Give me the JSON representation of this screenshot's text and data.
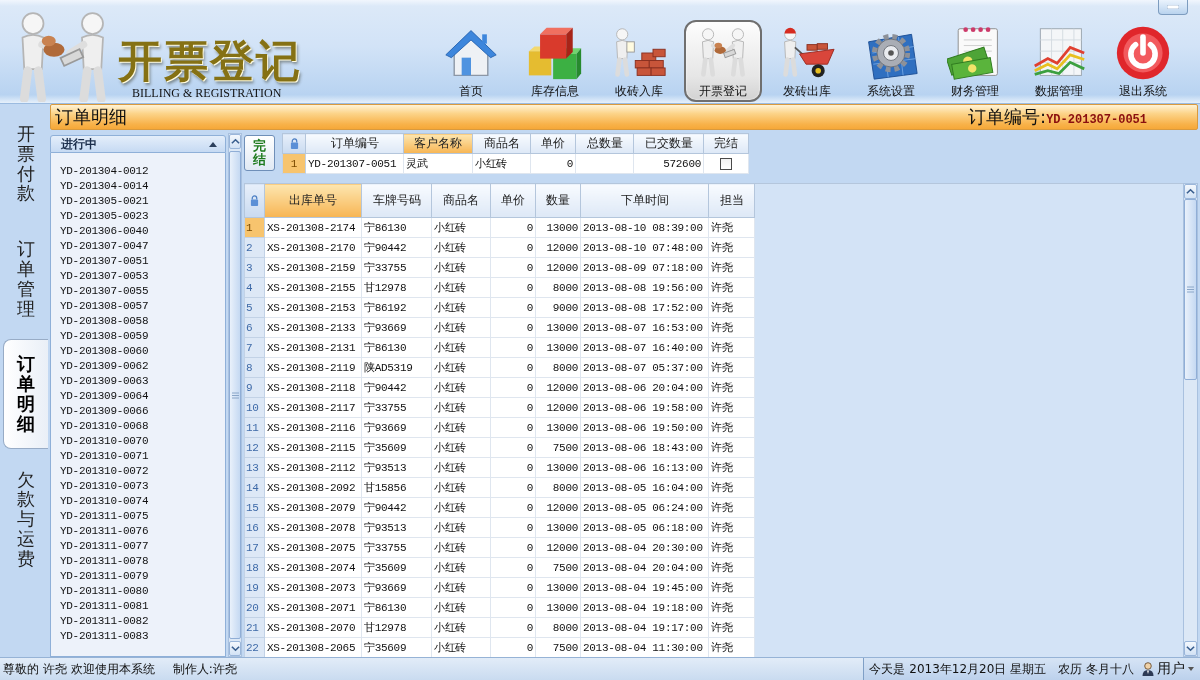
{
  "header": {
    "title": "开票登记",
    "subtitle": "BILLING & REGISTRATION",
    "nav": [
      {
        "label": "首页",
        "kind": "home",
        "selected": false
      },
      {
        "label": "库存信息",
        "kind": "boxes",
        "selected": false
      },
      {
        "label": "收砖入库",
        "kind": "bricks",
        "selected": false
      },
      {
        "label": "开票登记",
        "kind": "handover",
        "selected": true
      },
      {
        "label": "发砖出库",
        "kind": "wheelbarrow",
        "selected": false
      },
      {
        "label": "系统设置",
        "kind": "gear",
        "selected": false
      },
      {
        "label": "财务管理",
        "kind": "money",
        "selected": false
      },
      {
        "label": "数据管理",
        "kind": "chart",
        "selected": false
      },
      {
        "label": "退出系统",
        "kind": "power",
        "selected": false
      }
    ]
  },
  "side_tabs": [
    {
      "label": "开票付款",
      "selected": false
    },
    {
      "label": "订单管理",
      "selected": false
    },
    {
      "label": "订单明细",
      "selected": true
    },
    {
      "label": "欠款与运费",
      "selected": false
    }
  ],
  "page_bar": {
    "title": "订单明细",
    "order_label": "订单编号:",
    "order_number": "YD-201307-0051"
  },
  "order_list": {
    "title": "进行中",
    "items": [
      "YD-201304-0012",
      "YD-201304-0014",
      "YD-201305-0021",
      "YD-201305-0023",
      "YD-201306-0040",
      "YD-201307-0047",
      "YD-201307-0051",
      "YD-201307-0053",
      "YD-201307-0055",
      "YD-201308-0057",
      "YD-201308-0058",
      "YD-201308-0059",
      "YD-201308-0060",
      "YD-201309-0062",
      "YD-201309-0063",
      "YD-201309-0064",
      "YD-201309-0066",
      "YD-201310-0068",
      "YD-201310-0070",
      "YD-201310-0071",
      "YD-201310-0072",
      "YD-201310-0073",
      "YD-201310-0074",
      "YD-201311-0075",
      "YD-201311-0076",
      "YD-201311-0077",
      "YD-201311-0078",
      "YD-201311-0079",
      "YD-201311-0080",
      "YD-201311-0081",
      "YD-201311-0082",
      "YD-201311-0083"
    ]
  },
  "order_summary": {
    "button": "完结",
    "columns": [
      {
        "label": "订单编号",
        "selected": false
      },
      {
        "label": "客户名称",
        "selected": true
      },
      {
        "label": "商品名",
        "selected": false
      },
      {
        "label": "单价",
        "selected": false
      },
      {
        "label": "总数量",
        "selected": false
      },
      {
        "label": "已交数量",
        "selected": false
      },
      {
        "label": "完结",
        "selected": false
      }
    ],
    "rows": [
      {
        "index": "1",
        "selected": true,
        "order_no": "YD-201307-0051",
        "customer": "灵武",
        "product": "小红砖",
        "unit_price": "0",
        "delivered": "572600",
        "checked": false
      }
    ]
  },
  "shipments": {
    "columns": [
      {
        "label": "出库单号",
        "selected": true
      },
      {
        "label": "车牌号码",
        "selected": false
      },
      {
        "label": "商品名",
        "selected": false
      },
      {
        "label": "单价",
        "selected": false
      },
      {
        "label": "数量",
        "selected": false
      },
      {
        "label": "下单时间",
        "selected": false
      },
      {
        "label": "担当",
        "selected": false
      }
    ],
    "rows": [
      {
        "index": "1",
        "selected": true,
        "cells": [
          "XS-201308-2174",
          "宁86130",
          "小红砖",
          "0",
          "13000",
          "2013-08-10 08:39:00",
          "许尧"
        ]
      },
      {
        "index": "2",
        "selected": false,
        "cells": [
          "XS-201308-2170",
          "宁90442",
          "小红砖",
          "0",
          "12000",
          "2013-08-10 07:48:00",
          "许尧"
        ]
      },
      {
        "index": "3",
        "selected": false,
        "cells": [
          "XS-201308-2159",
          "宁33755",
          "小红砖",
          "0",
          "12000",
          "2013-08-09 07:18:00",
          "许尧"
        ]
      },
      {
        "index": "4",
        "selected": false,
        "cells": [
          "XS-201308-2155",
          "甘12978",
          "小红砖",
          "0",
          "8000",
          "2013-08-08 19:56:00",
          "许尧"
        ]
      },
      {
        "index": "5",
        "selected": false,
        "cells": [
          "XS-201308-2153",
          "宁86192",
          "小红砖",
          "0",
          "9000",
          "2013-08-08 17:52:00",
          "许尧"
        ]
      },
      {
        "index": "6",
        "selected": false,
        "cells": [
          "XS-201308-2133",
          "宁93669",
          "小红砖",
          "0",
          "13000",
          "2013-08-07 16:53:00",
          "许尧"
        ]
      },
      {
        "index": "7",
        "selected": false,
        "cells": [
          "XS-201308-2131",
          "宁86130",
          "小红砖",
          "0",
          "13000",
          "2013-08-07 16:40:00",
          "许尧"
        ]
      },
      {
        "index": "8",
        "selected": false,
        "cells": [
          "XS-201308-2119",
          "陕AD5319",
          "小红砖",
          "0",
          "8000",
          "2013-08-07 05:37:00",
          "许尧"
        ]
      },
      {
        "index": "9",
        "selected": false,
        "cells": [
          "XS-201308-2118",
          "宁90442",
          "小红砖",
          "0",
          "12000",
          "2013-08-06 20:04:00",
          "许尧"
        ]
      },
      {
        "index": "10",
        "selected": false,
        "cells": [
          "XS-201308-2117",
          "宁33755",
          "小红砖",
          "0",
          "12000",
          "2013-08-06 19:58:00",
          "许尧"
        ]
      },
      {
        "index": "11",
        "selected": false,
        "cells": [
          "XS-201308-2116",
          "宁93669",
          "小红砖",
          "0",
          "13000",
          "2013-08-06 19:50:00",
          "许尧"
        ]
      },
      {
        "index": "12",
        "selected": false,
        "cells": [
          "XS-201308-2115",
          "宁35609",
          "小红砖",
          "0",
          "7500",
          "2013-08-06 18:43:00",
          "许尧"
        ]
      },
      {
        "index": "13",
        "selected": false,
        "cells": [
          "XS-201308-2112",
          "宁93513",
          "小红砖",
          "0",
          "13000",
          "2013-08-06 16:13:00",
          "许尧"
        ]
      },
      {
        "index": "14",
        "selected": false,
        "cells": [
          "XS-201308-2092",
          "甘15856",
          "小红砖",
          "0",
          "8000",
          "2013-08-05 16:04:00",
          "许尧"
        ]
      },
      {
        "index": "15",
        "selected": false,
        "cells": [
          "XS-201308-2079",
          "宁90442",
          "小红砖",
          "0",
          "12000",
          "2013-08-05 06:24:00",
          "许尧"
        ]
      },
      {
        "index": "16",
        "selected": false,
        "cells": [
          "XS-201308-2078",
          "宁93513",
          "小红砖",
          "0",
          "13000",
          "2013-08-05 06:18:00",
          "许尧"
        ]
      },
      {
        "index": "17",
        "selected": false,
        "cells": [
          "XS-201308-2075",
          "宁33755",
          "小红砖",
          "0",
          "12000",
          "2013-08-04 20:30:00",
          "许尧"
        ]
      },
      {
        "index": "18",
        "selected": false,
        "cells": [
          "XS-201308-2074",
          "宁35609",
          "小红砖",
          "0",
          "7500",
          "2013-08-04 20:04:00",
          "许尧"
        ]
      },
      {
        "index": "19",
        "selected": false,
        "cells": [
          "XS-201308-2073",
          "宁93669",
          "小红砖",
          "0",
          "13000",
          "2013-08-04 19:45:00",
          "许尧"
        ]
      },
      {
        "index": "20",
        "selected": false,
        "cells": [
          "XS-201308-2071",
          "宁86130",
          "小红砖",
          "0",
          "13000",
          "2013-08-04 19:18:00",
          "许尧"
        ]
      },
      {
        "index": "21",
        "selected": false,
        "cells": [
          "XS-201308-2070",
          "甘12978",
          "小红砖",
          "0",
          "8000",
          "2013-08-04 19:17:00",
          "许尧"
        ]
      },
      {
        "index": "22",
        "selected": false,
        "cells": [
          "XS-201308-2065",
          "宁35609",
          "小红砖",
          "0",
          "7500",
          "2013-08-04 11:30:00",
          "许尧"
        ]
      }
    ]
  },
  "status_bar": {
    "greeting": "尊敬的 许尧 欢迎使用本系统",
    "author": "制作人:许尧",
    "date": "今天是 2013年12月20日 星期五",
    "lunar_date": "农历 冬月十八",
    "user": "用户"
  }
}
